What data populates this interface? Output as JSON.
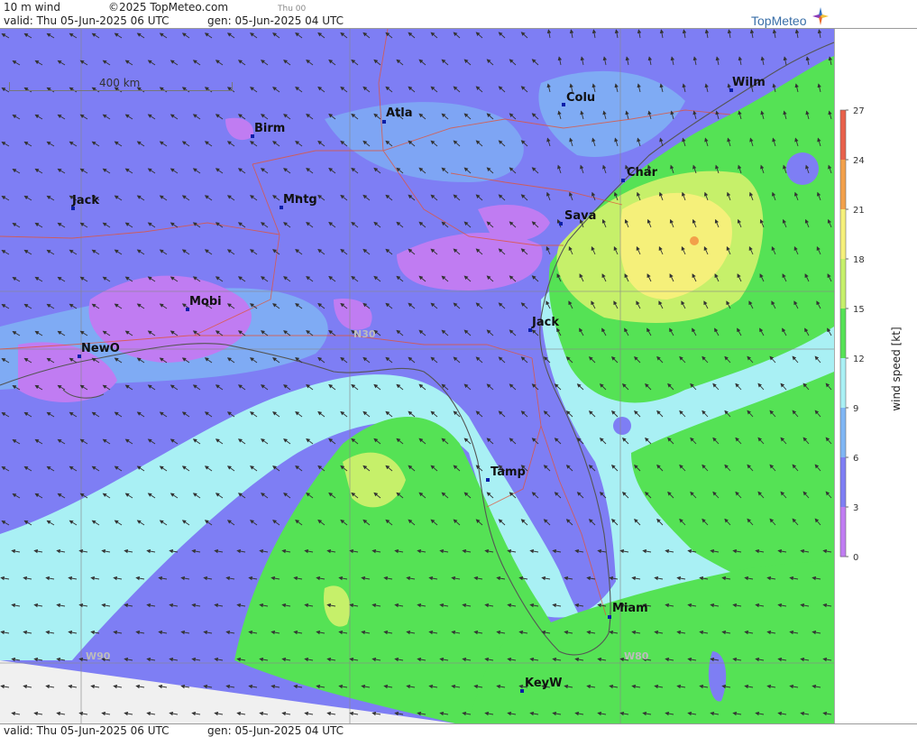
{
  "header": {
    "title": "10 m wind",
    "copyright": "©2025 TopMeteo.com",
    "valid": "valid:  Thu  05-Jun-2025  06 UTC",
    "gen": "gen: 05-Jun-2025 04 UTC",
    "day_code": "Thu 00",
    "logo": "TopMeteo"
  },
  "footer": {
    "valid": "valid:  Thu  05-Jun-2025  06 UTC",
    "gen": "gen: 05-Jun-2025 04 UTC"
  },
  "scale": {
    "label": "400 km"
  },
  "grid_labels": {
    "n30": "N30",
    "w90": "W90",
    "w80": "W80"
  },
  "cities": [
    {
      "name": "Atla"
    },
    {
      "name": "Birm"
    },
    {
      "name": "Colu"
    },
    {
      "name": "Wilm"
    },
    {
      "name": "Jack"
    },
    {
      "name": "Mntg"
    },
    {
      "name": "Char"
    },
    {
      "name": "Sava"
    },
    {
      "name": "Mobi"
    },
    {
      "name": "Jack"
    },
    {
      "name": "NewO"
    },
    {
      "name": "Tamp"
    },
    {
      "name": "Miam"
    },
    {
      "name": "KeyW"
    }
  ],
  "legend": {
    "title": "wind speed [kt]",
    "ticks": [
      "27",
      "24",
      "21",
      "18",
      "15",
      "12",
      "9",
      "6",
      "3",
      "0"
    ],
    "colors": [
      "#e8604a",
      "#f2a04a",
      "#f5f07a",
      "#c6f06a",
      "#55e255",
      "#a9f0f4",
      "#7fb6f4",
      "#7e7ef4",
      "#c07cf2"
    ]
  },
  "colors": {
    "calm": "#c07cf2",
    "light": "#7e7ef4",
    "moderate": "#7fb6f4",
    "fresh": "#a9f0f4",
    "strong": "#55e255",
    "stronger": "#c6f06a",
    "highest": "#f5f07a"
  }
}
